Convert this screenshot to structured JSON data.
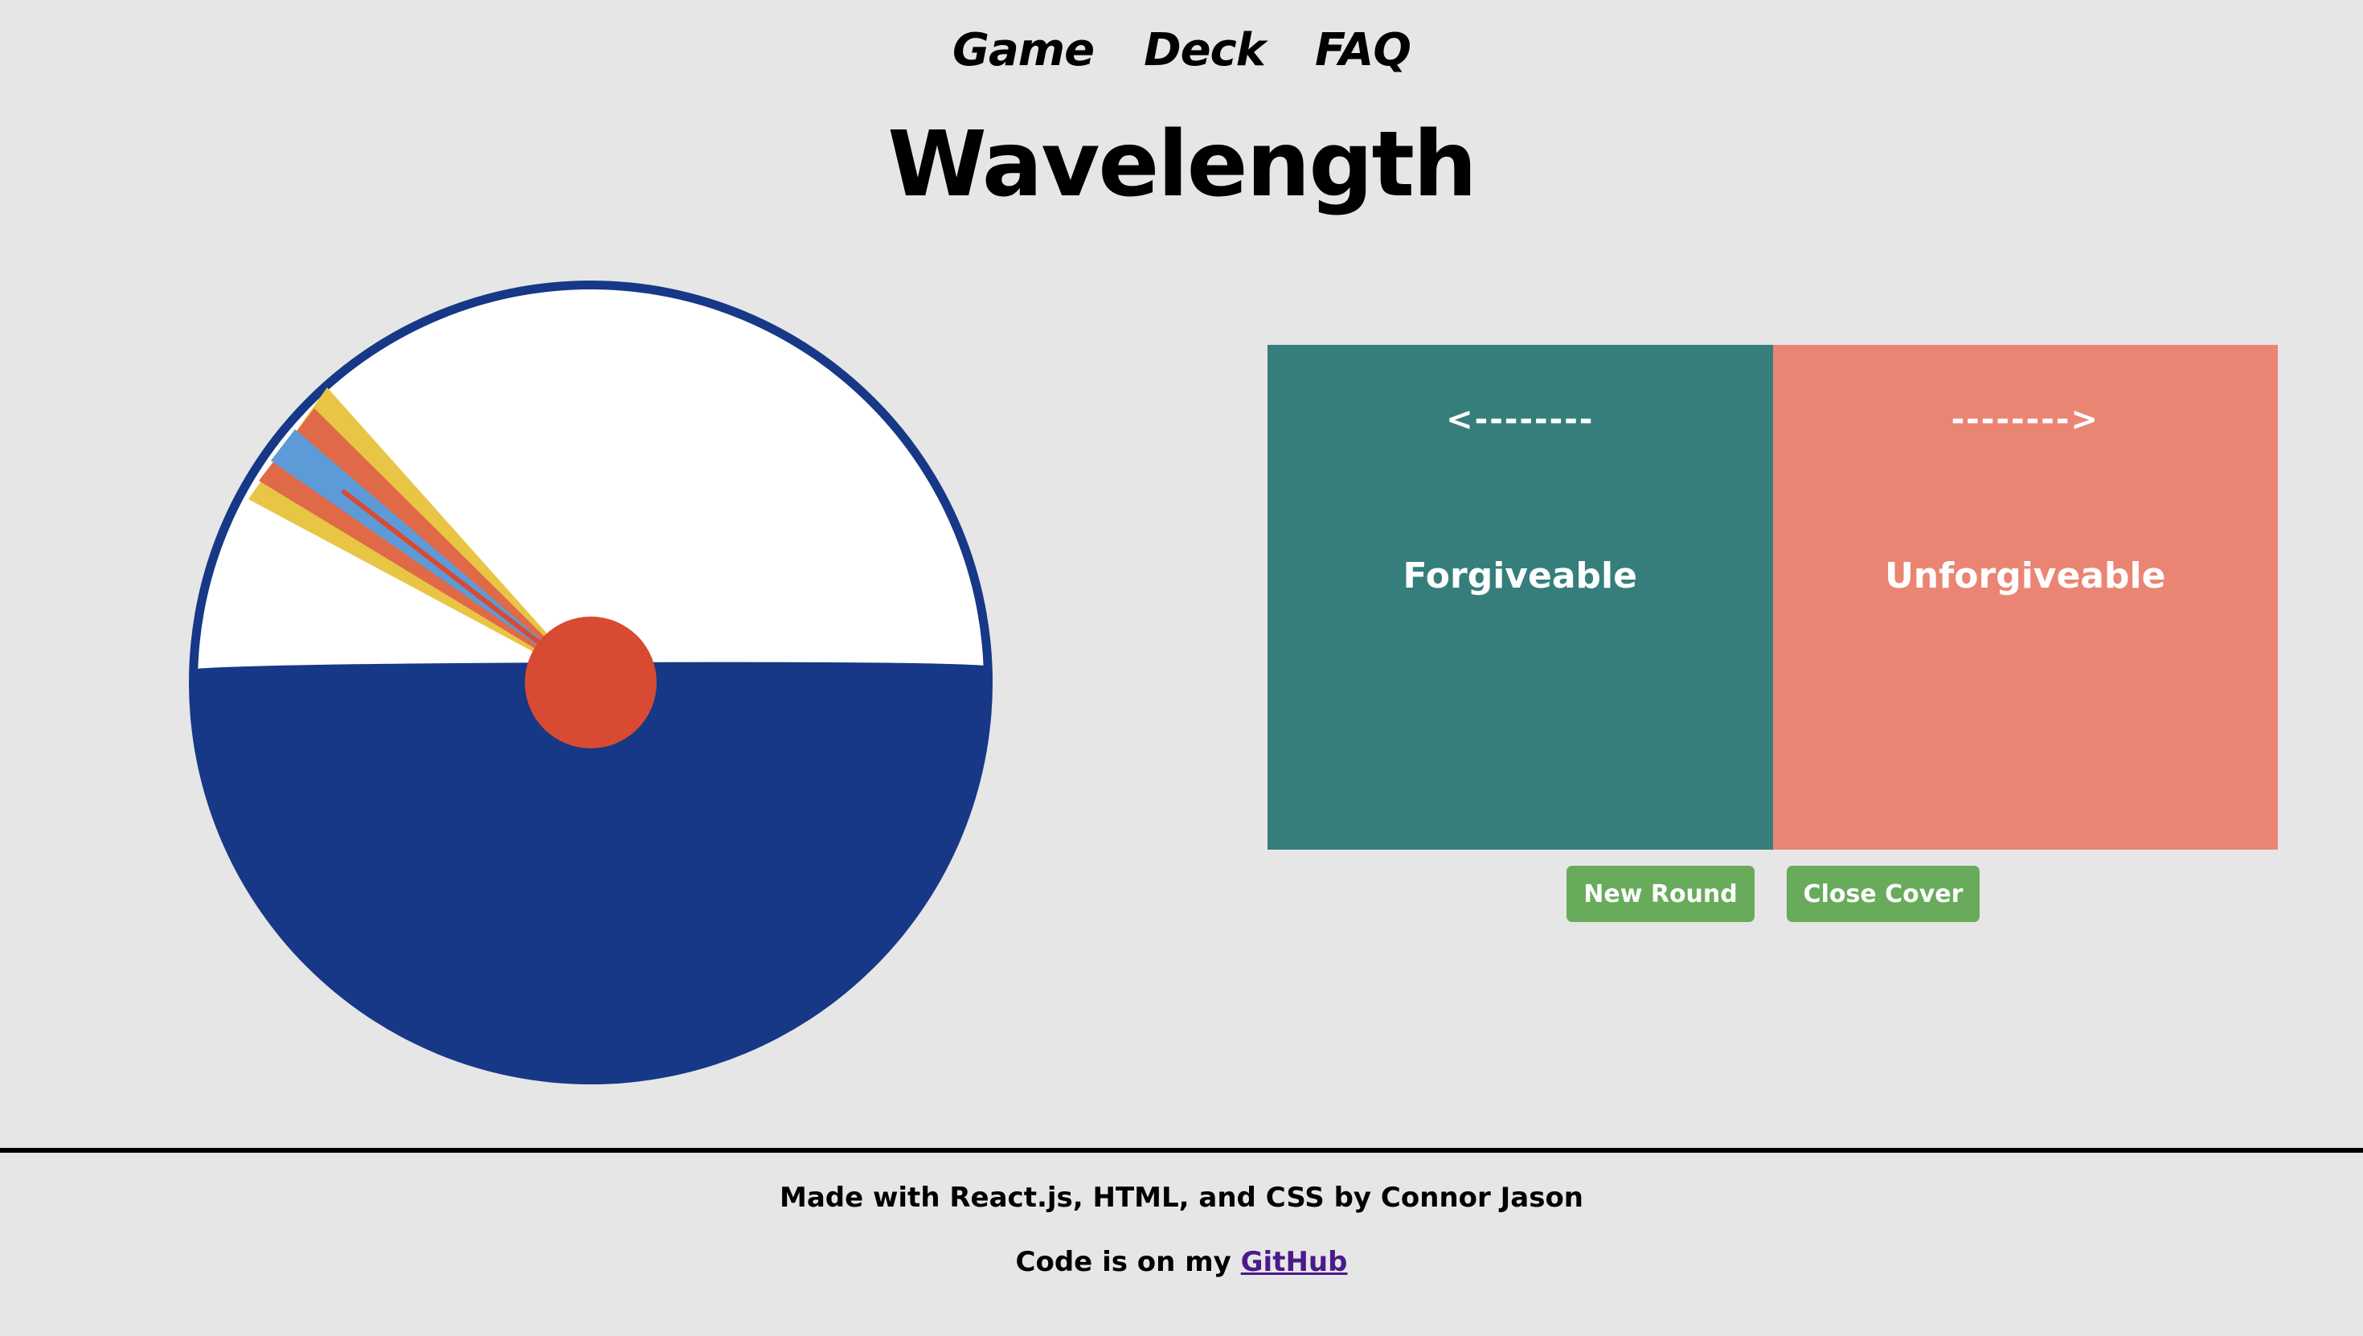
{
  "nav": {
    "items": [
      "Game",
      "Deck",
      "FAQ"
    ]
  },
  "title": "Wavelength",
  "dial": {
    "colors": {
      "rim": "#163887",
      "face": "#ffffff",
      "cover": "#163887",
      "needle": "#d94a32",
      "zone_outer": "#e8c545",
      "zone_mid": "#e06a47",
      "zone_center": "#5d9bd8"
    }
  },
  "card": {
    "left": {
      "arrow": "<--------",
      "word": "Forgiveable",
      "color": "#367e7c"
    },
    "right": {
      "arrow": "-------->",
      "word": "Unforgiveable",
      "color": "#ea8574"
    }
  },
  "buttons": {
    "new_round": "New Round",
    "close_cover": "Close Cover"
  },
  "footer": {
    "credit": "Made with React.js, HTML, and CSS by Connor Jason",
    "code_prefix": "Code is on my ",
    "github_label": "GitHub"
  }
}
